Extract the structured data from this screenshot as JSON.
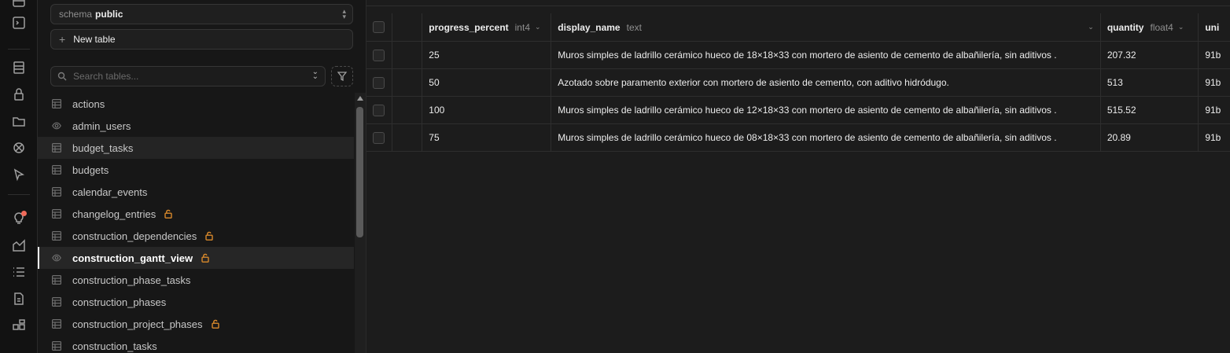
{
  "sidebar": {
    "schema_prefix": "schema",
    "schema_value": "public",
    "new_table_label": "New table",
    "search_placeholder": "Search tables...",
    "tables": [
      {
        "name": "actions",
        "icon": "table-icon",
        "locked": false
      },
      {
        "name": "admin_users",
        "icon": "view-icon",
        "locked": false
      },
      {
        "name": "budget_tasks",
        "icon": "table-icon",
        "locked": false
      },
      {
        "name": "budgets",
        "icon": "table-icon",
        "locked": false
      },
      {
        "name": "calendar_events",
        "icon": "table-icon",
        "locked": false
      },
      {
        "name": "changelog_entries",
        "icon": "table-icon",
        "locked": true
      },
      {
        "name": "construction_dependencies",
        "icon": "table-icon",
        "locked": true
      },
      {
        "name": "construction_gantt_view",
        "icon": "view-icon",
        "locked": true
      },
      {
        "name": "construction_phase_tasks",
        "icon": "table-icon",
        "locked": false
      },
      {
        "name": "construction_phases",
        "icon": "table-icon",
        "locked": false
      },
      {
        "name": "construction_project_phases",
        "icon": "table-icon",
        "locked": true
      },
      {
        "name": "construction_tasks",
        "icon": "table-icon",
        "locked": false
      }
    ],
    "active_table": "construction_gantt_view",
    "hovered_table": "budget_tasks"
  },
  "grid": {
    "columns": [
      {
        "name": "progress_percent",
        "type": "int4"
      },
      {
        "name": "display_name",
        "type": "text"
      },
      {
        "name": "quantity",
        "type": "float4"
      },
      {
        "name": "uni",
        "type": ""
      }
    ],
    "rows": [
      {
        "progress_percent": "25",
        "display_name": "Muros simples de ladrillo cerámico hueco de 18×18×33 con mortero de asiento de cemento de albañilería, sin aditivos .",
        "quantity": "207.32",
        "unit": "91b"
      },
      {
        "progress_percent": "50",
        "display_name": "Azotado sobre paramento exterior con mortero de asiento de cemento, con aditivo hidródugo.",
        "quantity": "513",
        "unit": "91b"
      },
      {
        "progress_percent": "100",
        "display_name": "Muros simples de ladrillo cerámico hueco de 12×18×33 con mortero de asiento de cemento de albañilería, sin aditivos .",
        "quantity": "515.52",
        "unit": "91b"
      },
      {
        "progress_percent": "75",
        "display_name": "Muros simples de ladrillo cerámico hueco de 08×18×33 con mortero de asiento de cemento de albañilería, sin aditivos .",
        "quantity": "20.89",
        "unit": "91b"
      }
    ]
  },
  "colors": {
    "accent_lock": "#d9892b",
    "notification_dot": "#f06a5a",
    "background": "#1c1c1c"
  }
}
